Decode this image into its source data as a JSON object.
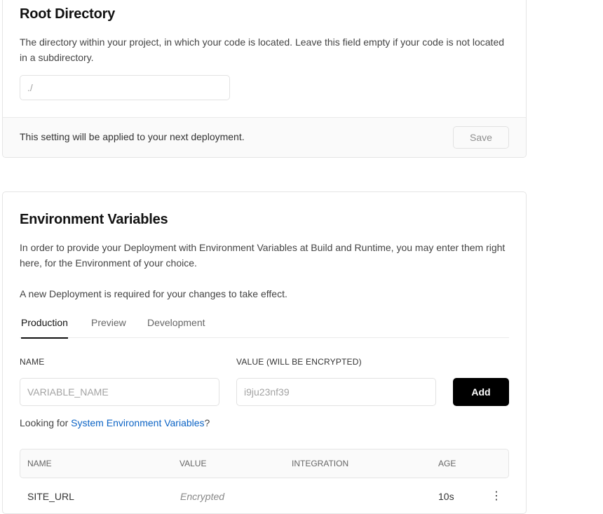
{
  "root_directory": {
    "title": "Root Directory",
    "description": "The directory within your project, in which your code is located. Leave this field empty if your code is not located in a subdirectory.",
    "input_placeholder": "./",
    "footer_text": "This setting will be applied to your next deployment.",
    "save_label": "Save"
  },
  "env_vars": {
    "title": "Environment Variables",
    "description": "In order to provide your Deployment with Environment Variables at Build and Runtime, you may enter them right here, for the Environment of your choice.",
    "note": "A new Deployment is required for your changes to take effect.",
    "tabs": [
      {
        "label": "Production",
        "active": true
      },
      {
        "label": "Preview",
        "active": false
      },
      {
        "label": "Development",
        "active": false
      }
    ],
    "name_label": "NAME",
    "value_label": "VALUE (WILL BE ENCRYPTED)",
    "name_placeholder": "VARIABLE_NAME",
    "value_placeholder": "i9ju23nf39",
    "add_label": "Add",
    "looking_prefix": "Looking for ",
    "looking_link": "System Environment Variables",
    "looking_suffix": "?",
    "table": {
      "headers": [
        "NAME",
        "VALUE",
        "INTEGRATION",
        "AGE"
      ],
      "rows": [
        {
          "name": "SITE_URL",
          "value": "Encrypted",
          "integration": "",
          "age": "10s"
        }
      ]
    },
    "link_color": "#0b63c5"
  }
}
